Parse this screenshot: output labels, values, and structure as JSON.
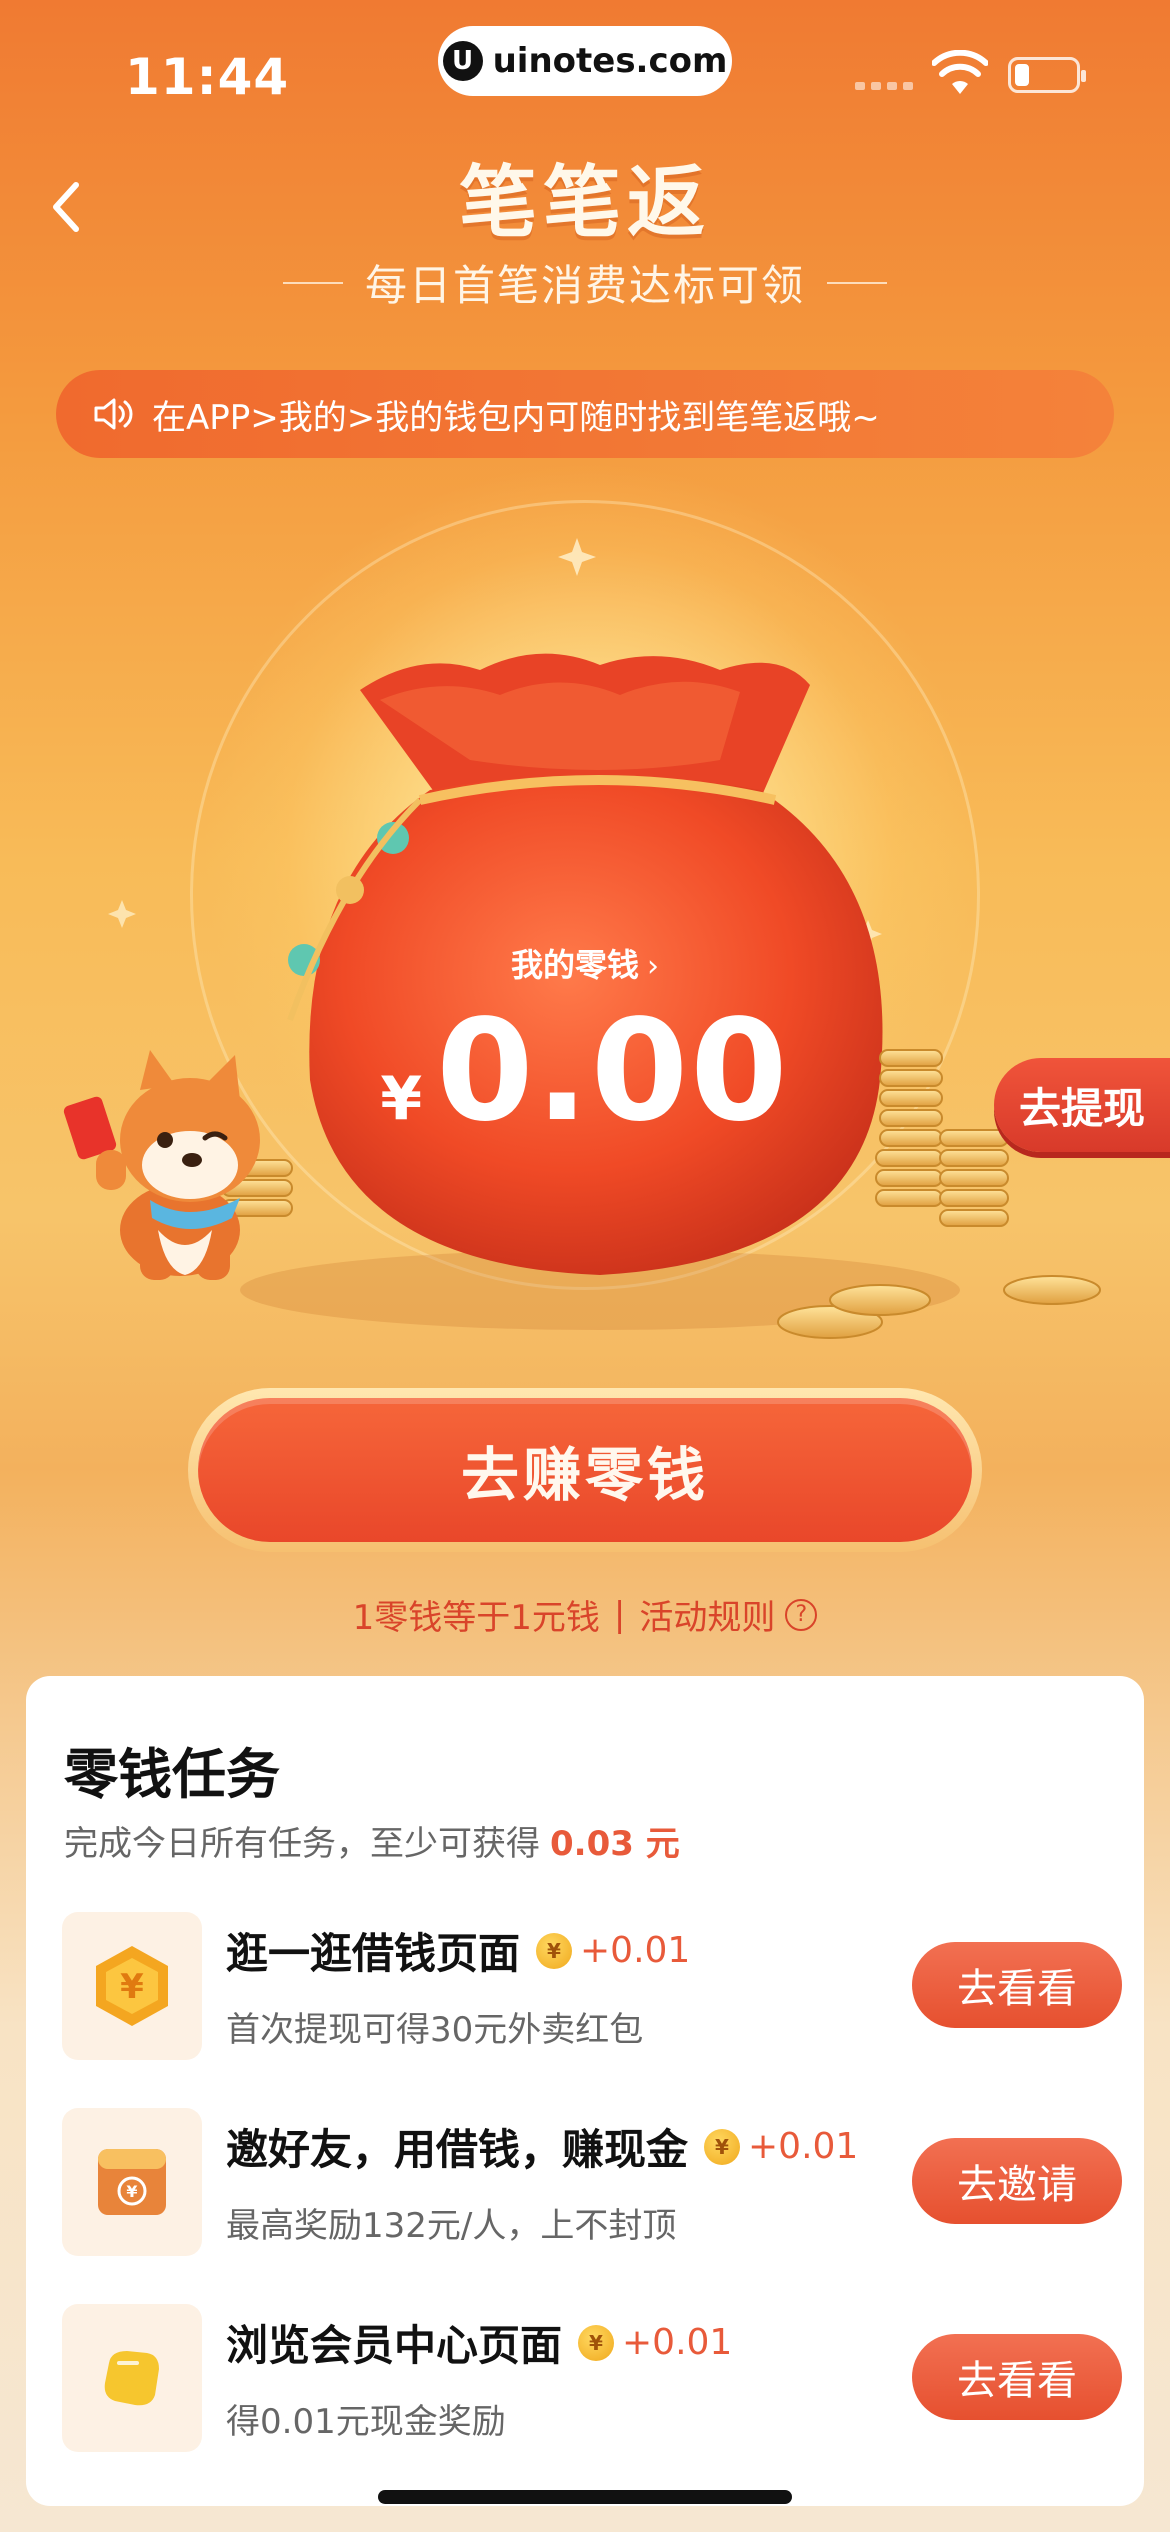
{
  "status": {
    "time": "11:44",
    "url": "uinotes.com",
    "url_logo": "U"
  },
  "header": {
    "title": "笔笔返",
    "subtitle": "每日首笔消费达标可领",
    "notice": "在APP>我的>我的钱包内可随时找到笔笔返哦~"
  },
  "hero": {
    "withdraw_label": "去提现",
    "balance_label": "我的零钱",
    "balance_chevron": "›",
    "currency": "¥",
    "balance": "0.00"
  },
  "earn_button": "去赚零钱",
  "rules": {
    "left": "1零钱等于1元钱",
    "sep": "|",
    "right": "活动规则",
    "q": "?"
  },
  "tasks_card": {
    "title": "零钱任务",
    "subtitle": "完成今日所有任务，至少可获得",
    "subtitle_amount": "0.03 元",
    "items": [
      {
        "name": "逛一逛借钱页面",
        "reward": "+0.01",
        "desc": "首次提现可得30元外卖红包",
        "button": "去看看",
        "icon": "coin-hexagon-icon"
      },
      {
        "name": "邀好友，用借钱，赚现金",
        "reward": "+0.01",
        "desc": "最高奖励132元/人，上不封顶",
        "button": "去邀请",
        "icon": "money-envelope-icon"
      },
      {
        "name": "浏览会员中心页面",
        "reward": "+0.01",
        "desc": "得0.01元现金奖励",
        "button": "去看看",
        "icon": "yellow-badge-icon"
      }
    ],
    "coin_symbol": "¥"
  },
  "colors": {
    "accent": "#e85a3a",
    "brand_orange": "#f07a32",
    "button_red": "#e6502f"
  }
}
